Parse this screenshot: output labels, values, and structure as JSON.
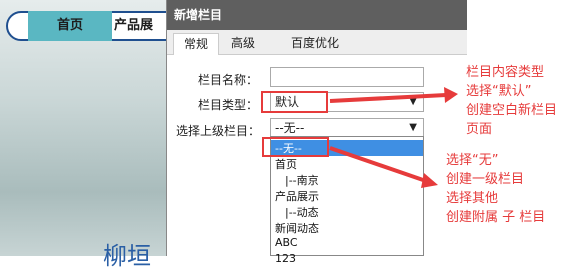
{
  "nav": {
    "home": "首页",
    "products": "产品展"
  },
  "background_text": "柳垣",
  "dialog": {
    "title": "新增栏目",
    "tabs": [
      "常规",
      "高级",
      "百度优化"
    ],
    "fields": {
      "name_label": "栏目名称：",
      "name_value": "",
      "type_label": "栏目类型：",
      "type_value": "默认",
      "parent_label": "选择上级栏目：",
      "parent_value": "--无--"
    },
    "options": [
      "--无--",
      "首页",
      "|--南京",
      "产品展示",
      "|--动态",
      "新闻动态",
      "ABC",
      "123"
    ]
  },
  "annotations": {
    "type_note": [
      "栏目内容类型",
      "选择“默认”",
      "创建空白新栏目",
      "页面"
    ],
    "parent_note": [
      "选择“无”",
      "创建一级栏目",
      "选择其他",
      "创建附属   子 栏目"
    ]
  },
  "colors": {
    "annotation": "#e63b3b",
    "selected": "#3f8fe3",
    "dialog_title": "#5f5f5f"
  }
}
